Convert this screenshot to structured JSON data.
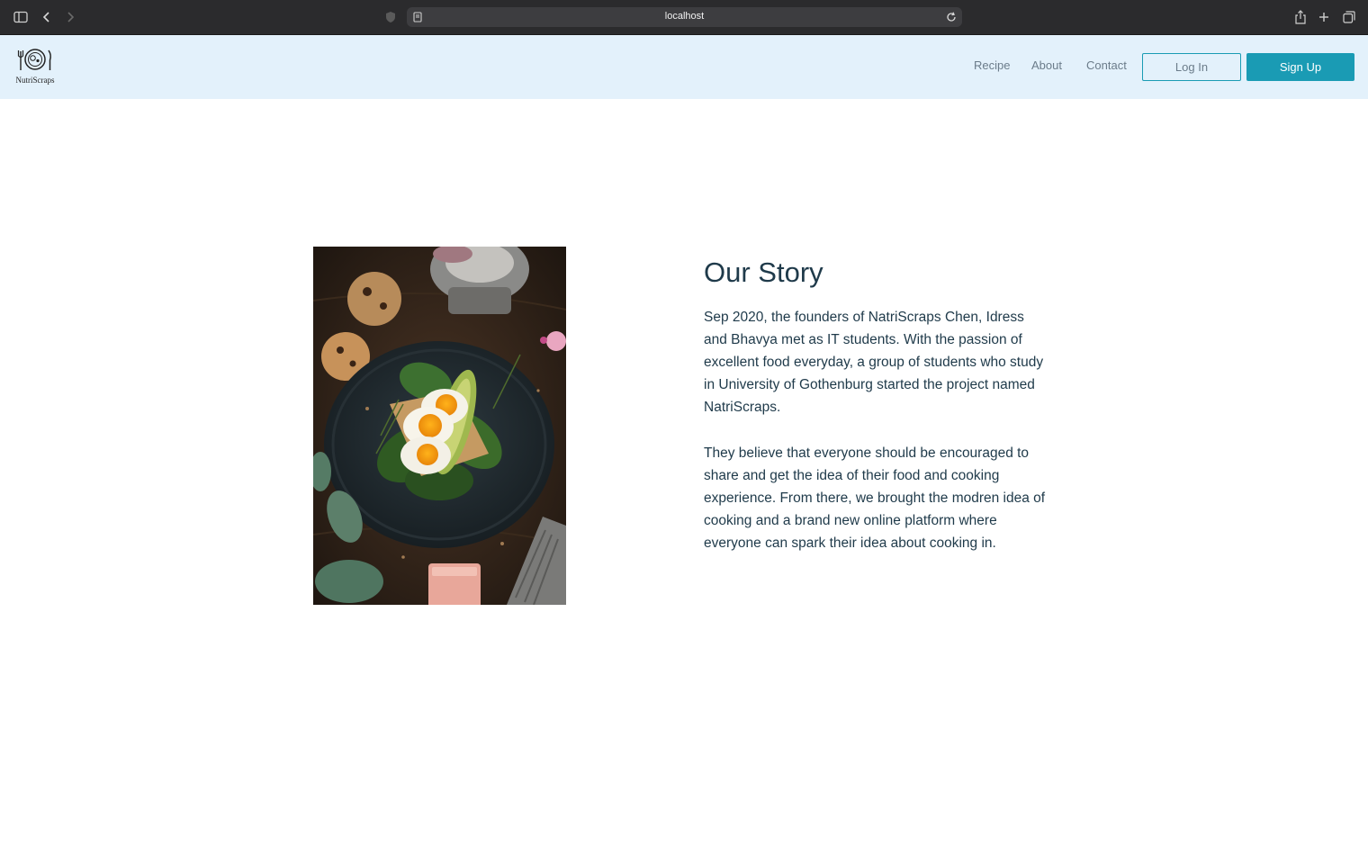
{
  "browser": {
    "url": "localhost"
  },
  "header": {
    "logo_text": "NutriScraps",
    "nav": [
      "Recipe",
      "About",
      "Contact"
    ],
    "login_label": "Log In",
    "signup_label": "Sign Up",
    "accent_color": "#1a9bb4",
    "background_color": "#e3f1fb"
  },
  "story": {
    "title": "Our Story",
    "paragraph1": "Sep 2020, the founders of NatriScraps Chen, Idress and Bhavya met as IT students. With the passion of excellent food everyday, a group of students who study in University of Gothenburg started the project named NatriScraps.",
    "paragraph2": "They believe that everyone should be encouraged to share and get the idea of their food and cooking experience. From there, we brought the modren idea of cooking and a brand new online platform where everyone can spark their idea about cooking in.",
    "image": "food-photo"
  }
}
